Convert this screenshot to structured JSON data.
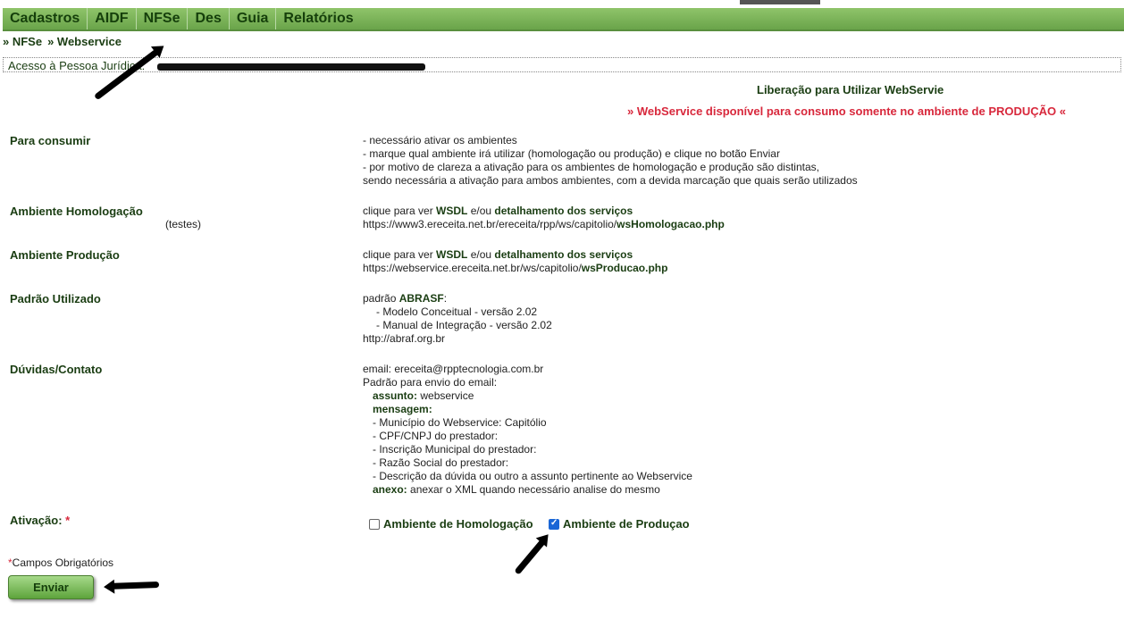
{
  "menu": {
    "items": [
      {
        "label": "Cadastros"
      },
      {
        "label": "AIDF"
      },
      {
        "label": "NFSe"
      },
      {
        "label": "Des"
      },
      {
        "label": "Guia"
      },
      {
        "label": "Relatórios"
      }
    ]
  },
  "breadcrumb": {
    "item1": "» NFSe",
    "item2": "» Webservice"
  },
  "access": {
    "label": "Acesso à Pessoa Jurídica:"
  },
  "page": {
    "title": "Liberação para Utilizar WebServie",
    "warning": "» WebService disponível para consumo somente no ambiente de PRODUÇÃO «"
  },
  "consumir": {
    "label": "Para consumir",
    "lines": [
      "- necessário ativar os ambientes",
      "- marque qual ambiente irá utilizar (homologação ou produção) e clique no botão Enviar",
      "- por motivo de clareza a ativação para os ambientes de homologação e produção são distintas,",
      "sendo necessária a ativação para ambos ambientes, com a devida marcação que quais serão utilizados"
    ]
  },
  "homologacao": {
    "label": "Ambiente Homologação",
    "sub": "(testes)",
    "prefix": "clique para ver ",
    "wsdl": "WSDL",
    "mid": " e/ou ",
    "detalhe": "detalhamento dos serviços",
    "url_base": "https://www3.ereceita.net.br/ereceita/rpp/ws/capitolio/",
    "url_file": "wsHomologacao.php"
  },
  "producao": {
    "label": "Ambiente Produção",
    "prefix": "clique para ver ",
    "wsdl": "WSDL",
    "mid": " e/ou ",
    "detalhe": "detalhamento dos serviços",
    "url_base": "https://webservice.ereceita.net.br/ws/capitolio/",
    "url_file": "wsProducao.php"
  },
  "padrao": {
    "label": "Padrão Utilizado",
    "prefix": "padrão ",
    "name": "ABRASF",
    "suffix": ":",
    "l1": "- Modelo Conceitual - versão 2.02",
    "l2": "- Manual de Integração - versão 2.02",
    "l3": "http://abraf.org.br"
  },
  "duvidas": {
    "label": "Dúvidas/Contato",
    "email": "email: ereceita@rpptecnologia.com.br",
    "padrao": "Padrão para envio do email:",
    "assunto_label": "assunto:",
    "assunto_value": " webservice",
    "mensagem_label": "mensagem:",
    "items": [
      "- Município do Webservice: Capitólio",
      "- CPF/CNPJ do prestador:",
      "- Inscrição Municipal do prestador:",
      "- Razão Social do prestador:",
      "- Descrição da dúvida ou outro a assunto pertinente ao Webservice"
    ],
    "anexo_label": "anexo:",
    "anexo_value": " anexar o XML quando necessário analise do mesmo"
  },
  "ativacao": {
    "label": "Ativação:",
    "req": "*",
    "homolog_label": "Ambiente de Homologação",
    "homolog_checked": false,
    "prod_label": "Ambiente de Produçao",
    "prod_checked": true
  },
  "footer": {
    "req": "*",
    "obrig": "Campos Obrigatórios",
    "enviar": "Enviar"
  }
}
